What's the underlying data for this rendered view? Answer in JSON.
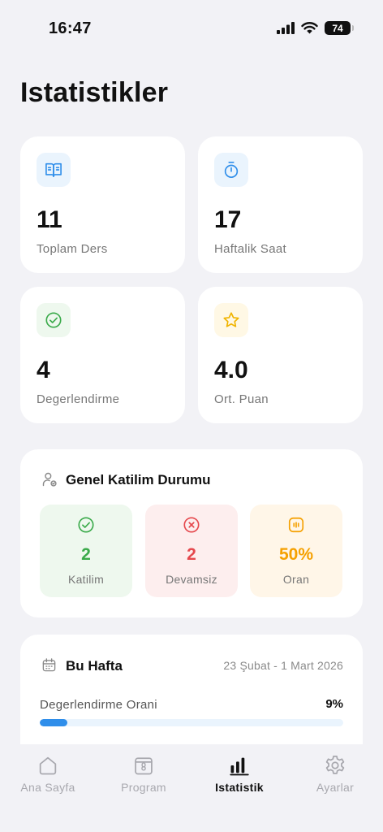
{
  "status_bar": {
    "time": "16:47",
    "battery": "74"
  },
  "page": {
    "title": "Istatistikler"
  },
  "stats": [
    {
      "value": "11",
      "label": "Toplam Ders",
      "icon": "book-icon",
      "color": "#2f8eea"
    },
    {
      "value": "17",
      "label": "Haftalik Saat",
      "icon": "stopwatch-icon",
      "color": "#2f8eea"
    },
    {
      "value": "4",
      "label": "Degerlendirme",
      "icon": "check-circle-icon",
      "color": "#3aaa4a"
    },
    {
      "value": "4.0",
      "label": "Ort. Puan",
      "icon": "star-icon",
      "color": "#f0b400"
    }
  ],
  "attendance": {
    "title": "Genel Katilim Durumu",
    "items": [
      {
        "value": "2",
        "label": "Katilim",
        "color": "#3aaa4a",
        "bg": "#eef8ee"
      },
      {
        "value": "2",
        "label": "Devamsiz",
        "color": "#e5484d",
        "bg": "#fdeeee"
      },
      {
        "value": "50%",
        "label": "Oran",
        "color": "#f5a000",
        "bg": "#fff6e8"
      }
    ]
  },
  "week": {
    "title": "Bu Hafta",
    "range": "23 Şubat - 1 Mart 2026",
    "rate_label": "Degerlendirme Orani",
    "rate_value": "9%",
    "rate_fraction": 0.09,
    "accent": "#2f8eea"
  },
  "tabs": [
    {
      "label": "Ana Sayfa",
      "icon": "home-icon",
      "active": false
    },
    {
      "label": "Program",
      "icon": "calendar-icon",
      "active": false
    },
    {
      "label": "Istatistik",
      "icon": "bar-chart-icon",
      "active": true
    },
    {
      "label": "Ayarlar",
      "icon": "gear-icon",
      "active": false
    }
  ]
}
